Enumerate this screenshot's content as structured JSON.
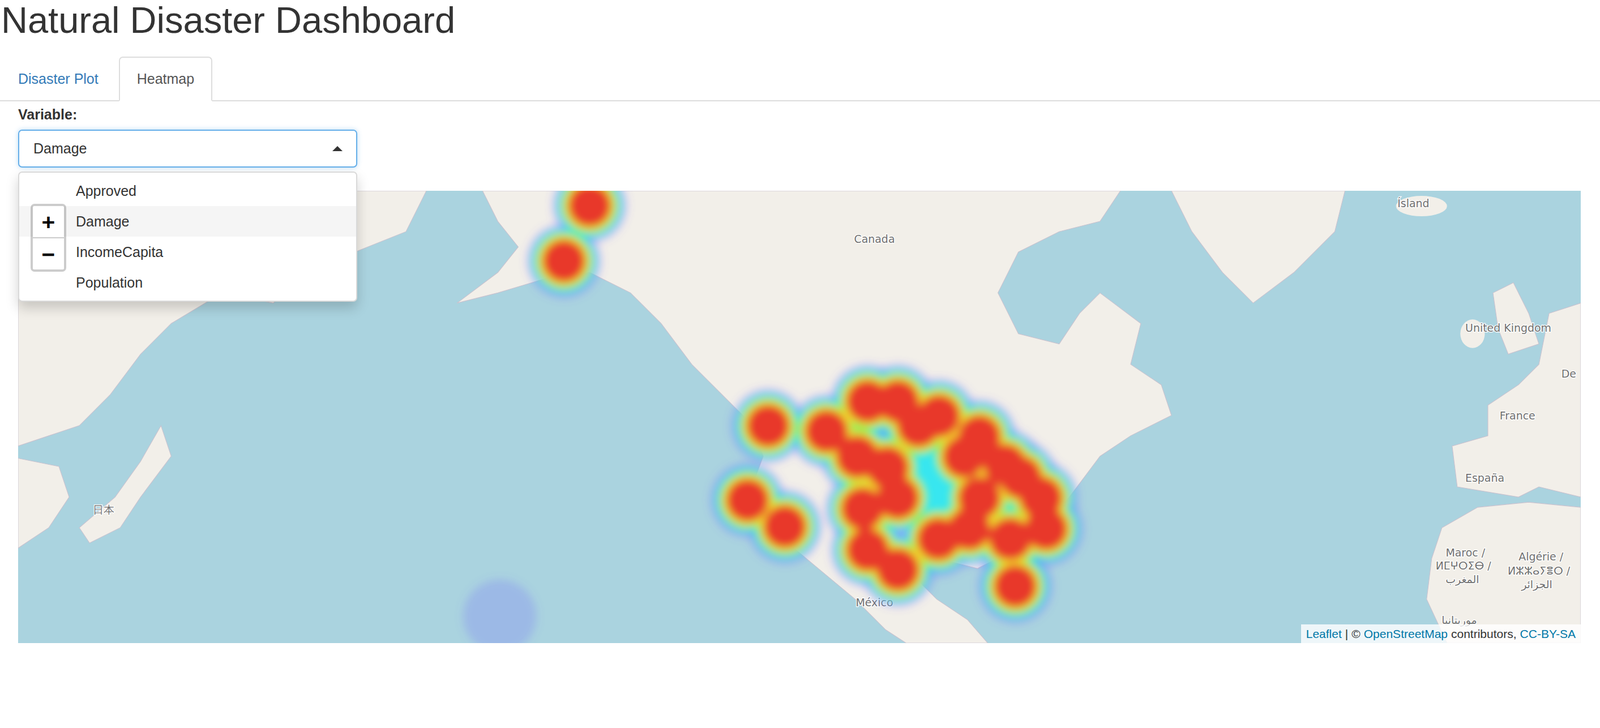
{
  "window": {
    "title": "Natural Disaster Dashboard"
  },
  "tabs": [
    {
      "label": "Disaster Plot",
      "selected": false
    },
    {
      "label": "Heatmap",
      "selected": true
    }
  ],
  "variable_select": {
    "label": "Variable:",
    "value": "Damage",
    "expanded": true,
    "options": [
      {
        "label": "Approved",
        "selected": false
      },
      {
        "label": "Damage",
        "selected": true
      },
      {
        "label": "IncomeCapita",
        "selected": false
      },
      {
        "label": "Population",
        "selected": false
      }
    ]
  },
  "map": {
    "zoom_controls": [
      "+",
      "−"
    ],
    "labels": [
      {
        "text": "Canada"
      },
      {
        "text": "Ísland"
      },
      {
        "text": "United Kingdom"
      },
      {
        "text": "France"
      },
      {
        "text": "España"
      },
      {
        "text": "De"
      },
      {
        "text": "Maroc /"
      },
      {
        "text": "ⵍⵎⵖⵔⵉⴱ /"
      },
      {
        "text": "المغرب"
      },
      {
        "text": "Algérie /"
      },
      {
        "text": "ⵍⵣⵣⴰⵢⴻⵔ /"
      },
      {
        "text": "الجزائر"
      },
      {
        "text": "موريتانيا"
      },
      {
        "text": "México"
      },
      {
        "text": "日本"
      }
    ],
    "heatmap": {
      "points": [
        {
          "lon": -146.3,
          "lat": 65.4,
          "weight": 1
        },
        {
          "lon": -150.3,
          "lat": 61.4,
          "weight": 1
        },
        {
          "lon": -118.5,
          "lat": 45.8,
          "weight": 1
        },
        {
          "lon": -121.7,
          "lat": 36.8,
          "weight": 1
        },
        {
          "lon": -115.9,
          "lat": 33.3,
          "weight": 1
        },
        {
          "lon": -109.4,
          "lat": 45.2,
          "weight": 1
        },
        {
          "lon": -103.0,
          "lat": 48.5,
          "weight": 1
        },
        {
          "lon": -98.3,
          "lat": 48.5,
          "weight": 1
        },
        {
          "lon": -95.1,
          "lat": 45.8,
          "weight": 1
        },
        {
          "lon": -104.6,
          "lat": 42.2,
          "weight": 1
        },
        {
          "lon": -99.9,
          "lat": 40.9,
          "weight": 1
        },
        {
          "lon": -91.9,
          "lat": 46.9,
          "weight": 1
        },
        {
          "lon": -85.6,
          "lat": 44.6,
          "weight": 1
        },
        {
          "lon": -88.0,
          "lat": 42.2,
          "weight": 1
        },
        {
          "lon": -85.6,
          "lat": 37.1,
          "weight": 1
        },
        {
          "lon": -81.6,
          "lat": 41.2,
          "weight": 1
        },
        {
          "lon": -79.2,
          "lat": 39.7,
          "weight": 1
        },
        {
          "lon": -76.0,
          "lat": 37.1,
          "weight": 1
        },
        {
          "lon": -75.2,
          "lat": 33.0,
          "weight": 1
        },
        {
          "lon": -80.8,
          "lat": 31.6,
          "weight": 1
        },
        {
          "lon": -80.0,
          "lat": 24.9,
          "weight": 1
        },
        {
          "lon": -103.0,
          "lat": 30.1,
          "weight": 1
        },
        {
          "lon": -98.3,
          "lat": 27.3,
          "weight": 1
        },
        {
          "lon": -92.0,
          "lat": 31.6,
          "weight": 1
        },
        {
          "lon": -87.2,
          "lat": 33.0,
          "weight": 1
        },
        {
          "lon": -98.3,
          "lat": 37.1,
          "weight": 1
        },
        {
          "lon": -103.8,
          "lat": 35.7,
          "weight": 1
        },
        {
          "lon": -92.7,
          "lat": 38.8,
          "weight": 0.5
        },
        {
          "lon": -160.3,
          "lat": 20.4,
          "weight": 0.15
        }
      ]
    },
    "attribution": [
      {
        "text": "Leaflet",
        "link": true
      },
      {
        "text": "|",
        "link": false
      },
      {
        "text": "©",
        "link": false
      },
      {
        "text": "OpenStreetMap",
        "link": true
      },
      {
        "text": "contributors,",
        "link": false
      },
      {
        "text": "CC-BY-SA",
        "link": true
      }
    ]
  }
}
